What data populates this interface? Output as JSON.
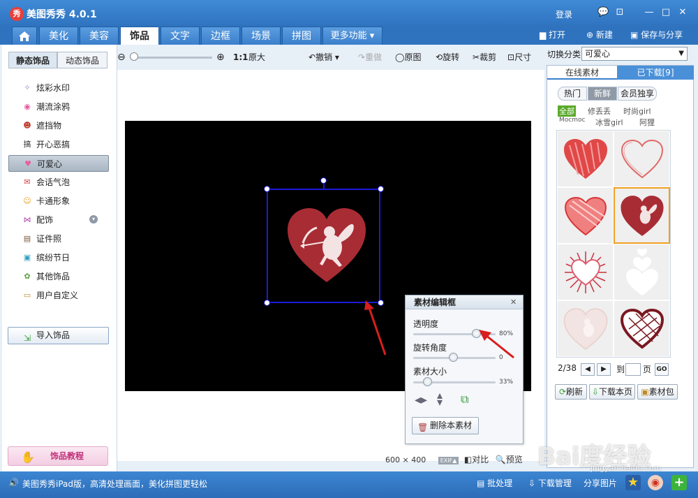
{
  "app": {
    "logo": "秀",
    "title": "美图秀秀 4.0.1",
    "login": "登录"
  },
  "window_controls": {
    "feedback": "💬",
    "skin": "⊡",
    "minimize": "—",
    "maximize": "□",
    "close": "✕"
  },
  "nav": {
    "tabs": [
      "美化",
      "美容",
      "饰品",
      "文字",
      "边框",
      "场景",
      "拼图",
      "更多功能 ▾"
    ],
    "active": "饰品",
    "open": "打开",
    "new": "新建",
    "save_share": "保存与分享"
  },
  "left_panel": {
    "subtabs": [
      "静态饰品",
      "动态饰品"
    ],
    "categories": [
      {
        "label": "炫彩水印",
        "icon": "✧",
        "color": "#9b7fd1"
      },
      {
        "label": "潮流涂鸦",
        "icon": "◉",
        "color": "#e05a9a"
      },
      {
        "label": "遮挡物",
        "icon": "☻",
        "color": "#c0392b"
      },
      {
        "label": "开心恶搞",
        "icon": "搞",
        "color": "#333333"
      },
      {
        "label": "可爱心",
        "icon": "♥",
        "color": "#e7609a"
      },
      {
        "label": "会话气泡",
        "icon": "✉",
        "color": "#d04040"
      },
      {
        "label": "卡通形象",
        "icon": "☺",
        "color": "#e8a020"
      },
      {
        "label": "配饰",
        "icon": "⋈",
        "color": "#b04cb0"
      },
      {
        "label": "证件照",
        "icon": "▤",
        "color": "#7a5a3a"
      },
      {
        "label": "缤纷节日",
        "icon": "▣",
        "color": "#30a0c0"
      },
      {
        "label": "其他饰品",
        "icon": "✿",
        "color": "#5aa040"
      },
      {
        "label": "用户自定义",
        "icon": "▭",
        "color": "#c08a20"
      }
    ],
    "active_category": "可爱心",
    "import_btn": "导入饰品",
    "tutorial_btn": "饰品教程"
  },
  "toolbar": {
    "zoom_ratio": "1:1",
    "original_size": "原大",
    "undo": "撤销",
    "redo": "重做",
    "original": "原图",
    "rotate": "旋转",
    "crop": "裁剪",
    "resize": "尺寸"
  },
  "canvas_info": {
    "width": "600",
    "height": "400",
    "exif": "EXIF▲",
    "compare": "对比",
    "preview": "预览"
  },
  "right_panel": {
    "switch_label": "切换分类",
    "switch_value": "可爱心",
    "tabs": [
      "在线素材",
      "已下载[9]"
    ],
    "filters": [
      "热门",
      "新鲜",
      "会员独享"
    ],
    "active_filter": "新鲜",
    "tags_row1": [
      "全部",
      "修丢丢",
      "时尚girl"
    ],
    "tags_row2": [
      "Mocmoc",
      "冰雪girl",
      "阿狸"
    ],
    "page": "2/38",
    "goto": "到",
    "page_unit": "页",
    "go": "GO",
    "refresh": "刷新",
    "download_page": "下载本页",
    "package": "素材包"
  },
  "edit_panel": {
    "title": "素材编辑框",
    "close": "✕",
    "opacity_label": "透明度",
    "opacity_value": "80%",
    "rotation_label": "旋转角度",
    "rotation_value": "0",
    "size_label": "素材大小",
    "size_value": "33%",
    "delete_btn": "删除本素材"
  },
  "status": {
    "message": "美图秀秀iPad版，高清处理画面，美化拼图更轻松",
    "batch": "批处理",
    "download_mgr": "下载管理",
    "share_pic": "分享图片",
    "watermark": "Bai度经验",
    "watermark_url": "jingyan.baidu.com"
  },
  "colors": {
    "accent_blue": "#2f73bf",
    "heart_red": "#a82c34",
    "selection_blue": "#1b1bd8",
    "arrow_red": "#d81e1e"
  }
}
